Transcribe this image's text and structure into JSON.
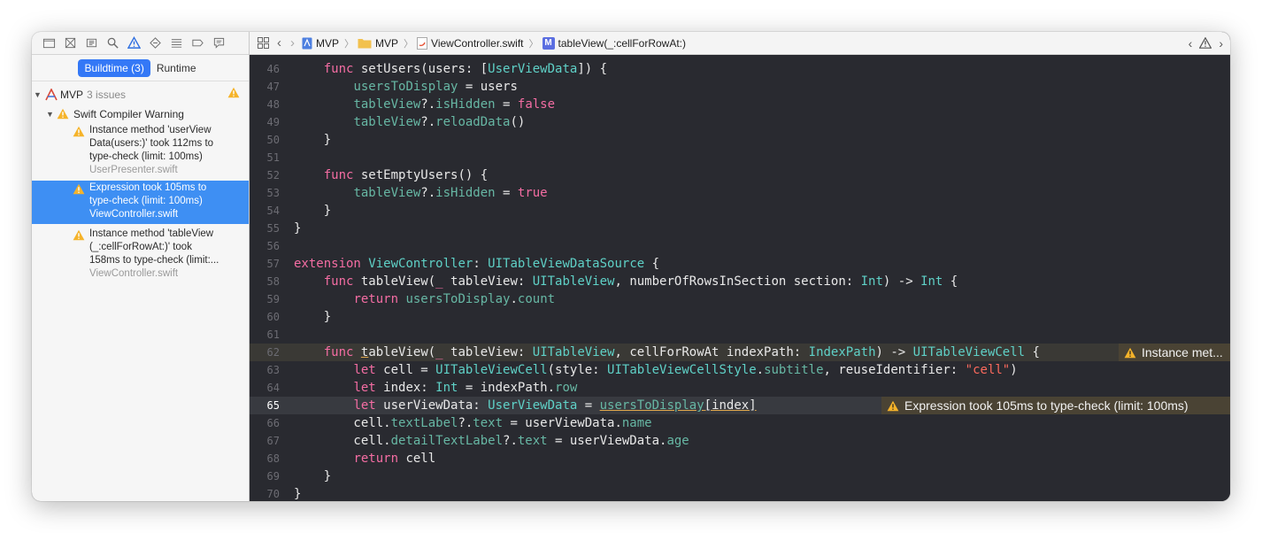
{
  "navigator": {
    "toolbar_icons": [
      "folder-icon",
      "source-control-icon",
      "symbol-icon",
      "find-icon",
      "issue-warning-icon",
      "test-icon",
      "debug-icon",
      "breakpoint-icon",
      "report-icon"
    ],
    "segments": {
      "buildtime": "Buildtime (3)",
      "runtime": "Runtime"
    },
    "project": {
      "name": "MVP",
      "issues": "3 issues"
    },
    "group": {
      "label": "Swift Compiler Warning"
    },
    "issues": [
      {
        "lines": [
          "Instance method 'userView",
          "Data(users:)' took 112ms to",
          "type-check (limit: 100ms)"
        ],
        "file": "UserPresenter.swift"
      },
      {
        "lines": [
          "Expression took 105ms to",
          "type-check (limit: 100ms)"
        ],
        "file": "ViewController.swift"
      },
      {
        "lines": [
          "Instance method 'tableView",
          "(_:cellForRowAt:)' took",
          "158ms to type-check (limit:..."
        ],
        "file": "ViewController.swift"
      }
    ]
  },
  "jumpbar": {
    "crumbs": [
      "MVP",
      "MVP",
      "ViewController.swift",
      "tableView(_:cellForRowAt:)"
    ]
  },
  "code": {
    "line_numbers": [
      "46",
      "47",
      "48",
      "49",
      "50",
      "51",
      "52",
      "53",
      "54",
      "55",
      "56",
      "57",
      "58",
      "59",
      "60",
      "61",
      "62",
      "63",
      "64",
      "65",
      "66",
      "67",
      "68",
      "69",
      "70"
    ],
    "warning_62": "Instance met...",
    "warning_65": "Expression took 105ms to type-check (limit: 100ms)"
  },
  "colors": {
    "keyword": "#f46da3",
    "type": "#5fd1c7",
    "property": "#67b7a4",
    "string": "#fc6a5d",
    "selection": "#3e8ff3",
    "warning": "#f5b32a"
  }
}
